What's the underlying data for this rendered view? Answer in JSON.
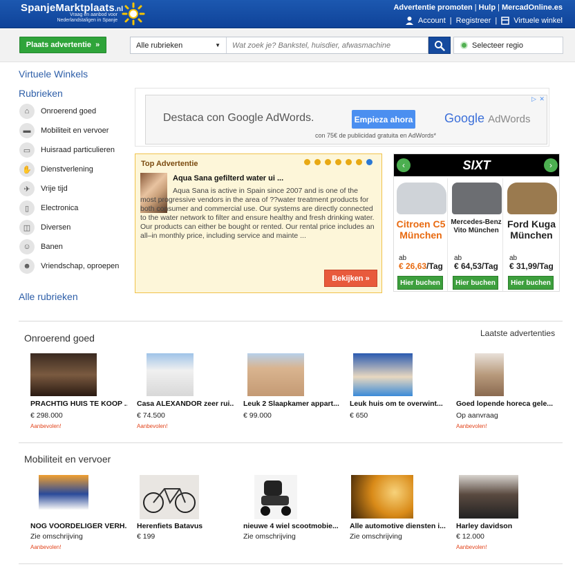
{
  "header": {
    "logo_title": "SpanjeMarktplaats",
    "logo_tld": ".nl",
    "logo_sub": "Vraag en aanbod voor Nederlandstaligen in Spanje",
    "links": [
      "Advertentie promoten",
      "Hulp",
      "MercadOnline.es"
    ],
    "account": "Account",
    "register": "Registreer",
    "virtual_store": "Virtuele winkel"
  },
  "search": {
    "place_ad": "Plaats advertentie",
    "place_ad_arrow": "»",
    "category": "Alle rubrieken",
    "placeholder": "Wat zoek je? Bankstel, huisdier, afwasmachine",
    "region": "Selecteer regio"
  },
  "sidebar": {
    "virtual_shops": "Virtuele Winkels",
    "rubrieken": "Rubrieken",
    "all_rubrieken": "Alle rubrieken",
    "items": [
      {
        "label": "Onroerend goed",
        "icon": "house-icon"
      },
      {
        "label": "Mobiliteit en vervoer",
        "icon": "car-icon"
      },
      {
        "label": "Huisraad particulieren",
        "icon": "sofa-icon"
      },
      {
        "label": "Dienstverlening",
        "icon": "handshake-icon"
      },
      {
        "label": "Vrije tijd",
        "icon": "plane-icon"
      },
      {
        "label": "Electronica",
        "icon": "devices-icon"
      },
      {
        "label": "Diversen",
        "icon": "box-icon"
      },
      {
        "label": "Banen",
        "icon": "worker-icon"
      },
      {
        "label": "Vriendschap, oproepen",
        "icon": "people-icon"
      }
    ]
  },
  "google_ad": {
    "text": "Destaca con Google AdWords.",
    "button": "Empieza ahora",
    "logo_google": "Google",
    "logo_adwords": "AdWords",
    "sub": "con 75€ de publicidad gratuita en AdWords*",
    "adchoices": "▷ ✕"
  },
  "top_ad": {
    "label": "Top Advertentie",
    "title": "Aqua Sana gefilterd water ui ...",
    "body": "Aqua Sana is active in Spain since 2007 and is one of the most progressive vendors in the area of ??water treatment products for both consumer and commercial use. Our systems are directly connected to the water network to filter and ensure healthy and fresh drinking water. Our products can either be bought or rented. Our rental price includes an all–in monthly price, including service and mainte ...",
    "button": "Bekijken »",
    "dots": 7,
    "active_dot": 7
  },
  "sixt": {
    "brand": "SIXT",
    "prev": "‹",
    "next": "›",
    "cars": [
      {
        "name": "Citroen C5 München",
        "ab": "ab",
        "price": "€ 26,63",
        "unit": "/Tag",
        "button": "Hier buchen",
        "color": "#cfd3d8"
      },
      {
        "name": "Mercedes-Benz Vito München",
        "ab": "ab",
        "price": "€ 64,53",
        "unit": "/Tag",
        "button": "Hier buchen",
        "color": "#6c6e72"
      },
      {
        "name": "Ford Kuga München",
        "ab": "ab",
        "price": "€ 31,99",
        "unit": "/Tag",
        "button": "Hier buchen",
        "color": "#9a7a4f"
      }
    ]
  },
  "sections": [
    {
      "title": "Onroerend goed",
      "extra": "Laatste advertenties",
      "items": [
        {
          "title": "PRACHTIG HUIS TE KOOP ...",
          "price": "€ 298.000",
          "badge": "Aanbevolen!",
          "img": "#7a5a40"
        },
        {
          "title": "Casa ALEXANDOR zeer rui...",
          "price": "€ 74.500",
          "badge": "Aanbevolen!",
          "img": "#dfe4ea"
        },
        {
          "title": "Leuk 2 Slaapkamer appart...",
          "price": "€ 99.000",
          "badge": "",
          "img": "#c9a98a"
        },
        {
          "title": "Leuk huis om te overwint...",
          "price": "€ 650",
          "badge": "",
          "img": "#3f6fb8"
        },
        {
          "title": "Goed lopende horeca gele...",
          "price": "Op aanvraag",
          "badge": "Aanbevolen!",
          "img": "#b89a7c"
        }
      ]
    },
    {
      "title": "Mobiliteit en vervoer",
      "extra": "",
      "items": [
        {
          "title": "NOG VOORDELIGER VERH...",
          "price": "Zie omschrijving",
          "badge": "Aanbevolen!",
          "img": "#e98a2a"
        },
        {
          "title": "Herenfiets Batavus",
          "price": "€ 199",
          "badge": "",
          "img": "#e9e6e2"
        },
        {
          "title": "nieuwe 4 wiel scootmobie...",
          "price": "Zie omschrijving",
          "badge": "",
          "img": "#f4f4f4"
        },
        {
          "title": "Alle automotive diensten i...",
          "price": "Zie omschrijving",
          "badge": "",
          "img": "#d98a18"
        },
        {
          "title": "Harley davidson",
          "price": "€ 12.000",
          "badge": "Aanbevolen!",
          "img": "#5a4a40"
        }
      ]
    }
  ]
}
